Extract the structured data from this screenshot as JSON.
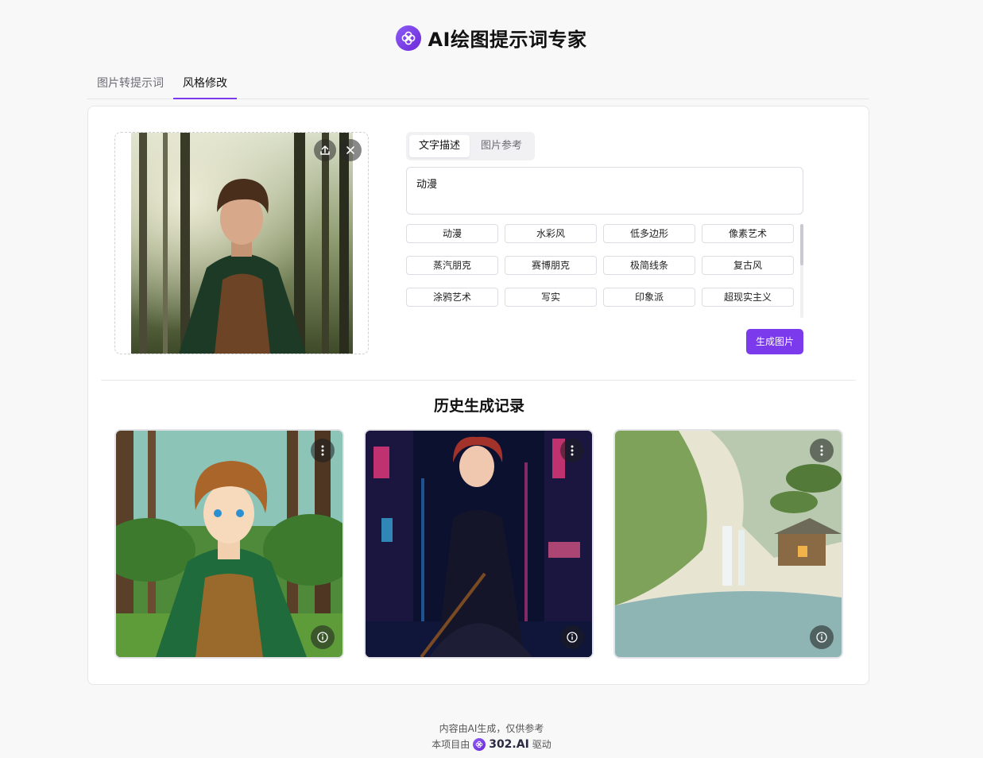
{
  "app": {
    "title": "AI绘图提示词专家"
  },
  "tabs": [
    {
      "label": "图片转提示词",
      "active": false
    },
    {
      "label": "风格修改",
      "active": true
    }
  ],
  "mode_switch": {
    "options": [
      "文字描述",
      "图片参考"
    ],
    "selected": "文字描述"
  },
  "prompt": {
    "value": "动漫"
  },
  "styles": [
    "动漫",
    "水彩风",
    "低多边形",
    "像素艺术",
    "蒸汽朋克",
    "赛博朋克",
    "极简线条",
    "复古风",
    "涂鸦艺术",
    "写实",
    "印象派",
    "超现实主义"
  ],
  "generate_button": {
    "label": "生成图片"
  },
  "history": {
    "title": "历史生成记录"
  },
  "footer": {
    "line1": "内容由AI生成，仅供参考",
    "line2_prefix": "本项目由",
    "brand": "302.AI",
    "line2_suffix": "驱动"
  },
  "colors": {
    "accent": "#7c3aed",
    "background": "#f8f8f9"
  },
  "icons": [
    "logo-icon",
    "upload-icon",
    "close-icon",
    "more-vertical-icon",
    "info-icon"
  ]
}
